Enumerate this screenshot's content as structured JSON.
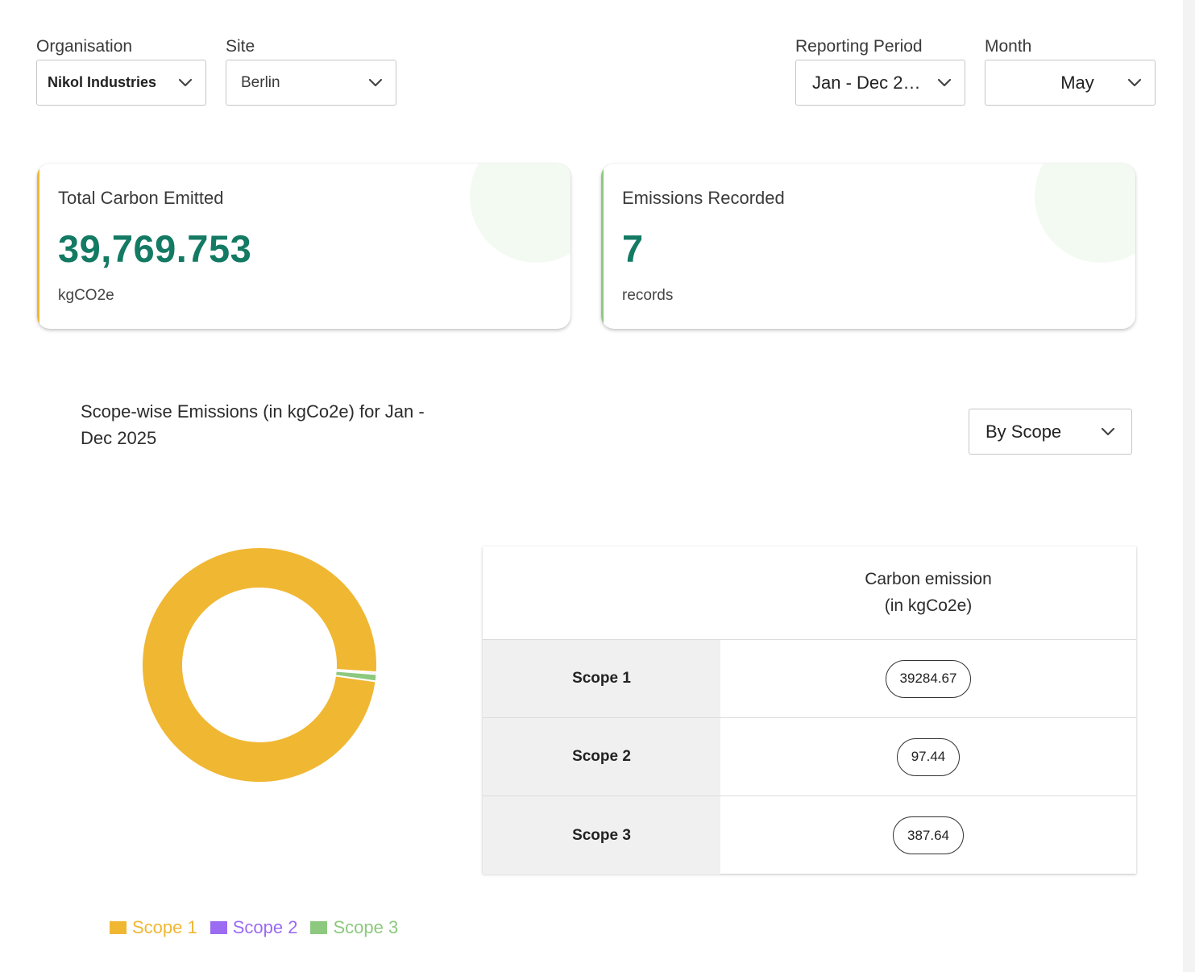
{
  "filters": {
    "organisation": {
      "label": "Organisation",
      "value": "Nikol Industries"
    },
    "site": {
      "label": "Site",
      "value": "Berlin"
    },
    "reporting_period": {
      "label": "Reporting Period",
      "value": "Jan - Dec 2025",
      "display": "Jan - Dec 2…"
    },
    "month": {
      "label": "Month",
      "value": "May"
    }
  },
  "cards": {
    "total_carbon": {
      "title": "Total Carbon Emitted",
      "value": "39,769.753",
      "unit": "kgCO2e",
      "accent": "#f0b733"
    },
    "emissions_recorded": {
      "title": "Emissions Recorded",
      "value": "7",
      "unit": "records",
      "accent": "#8cc97e"
    }
  },
  "chart_section": {
    "title": "Scope-wise Emissions (in kgCo2e) for Jan - Dec 2025",
    "group_by": "By Scope"
  },
  "chart_data": {
    "type": "pie",
    "categories": [
      "Scope 1",
      "Scope 2",
      "Scope 3"
    ],
    "values": [
      39284.67,
      97.44,
      387.64
    ],
    "colors": [
      "#f0b733",
      "#9b6bf2",
      "#8cc97e"
    ],
    "legend_position": "bottom-left"
  },
  "table": {
    "header_line1": "Carbon emission",
    "header_line2": "(in kgCo2e)",
    "rows": [
      {
        "name": "Scope 1",
        "value": "39284.67"
      },
      {
        "name": "Scope 2",
        "value": "97.44"
      },
      {
        "name": "Scope 3",
        "value": "387.64"
      }
    ]
  },
  "icons": {
    "dropdown": "chevron-down-icon"
  }
}
